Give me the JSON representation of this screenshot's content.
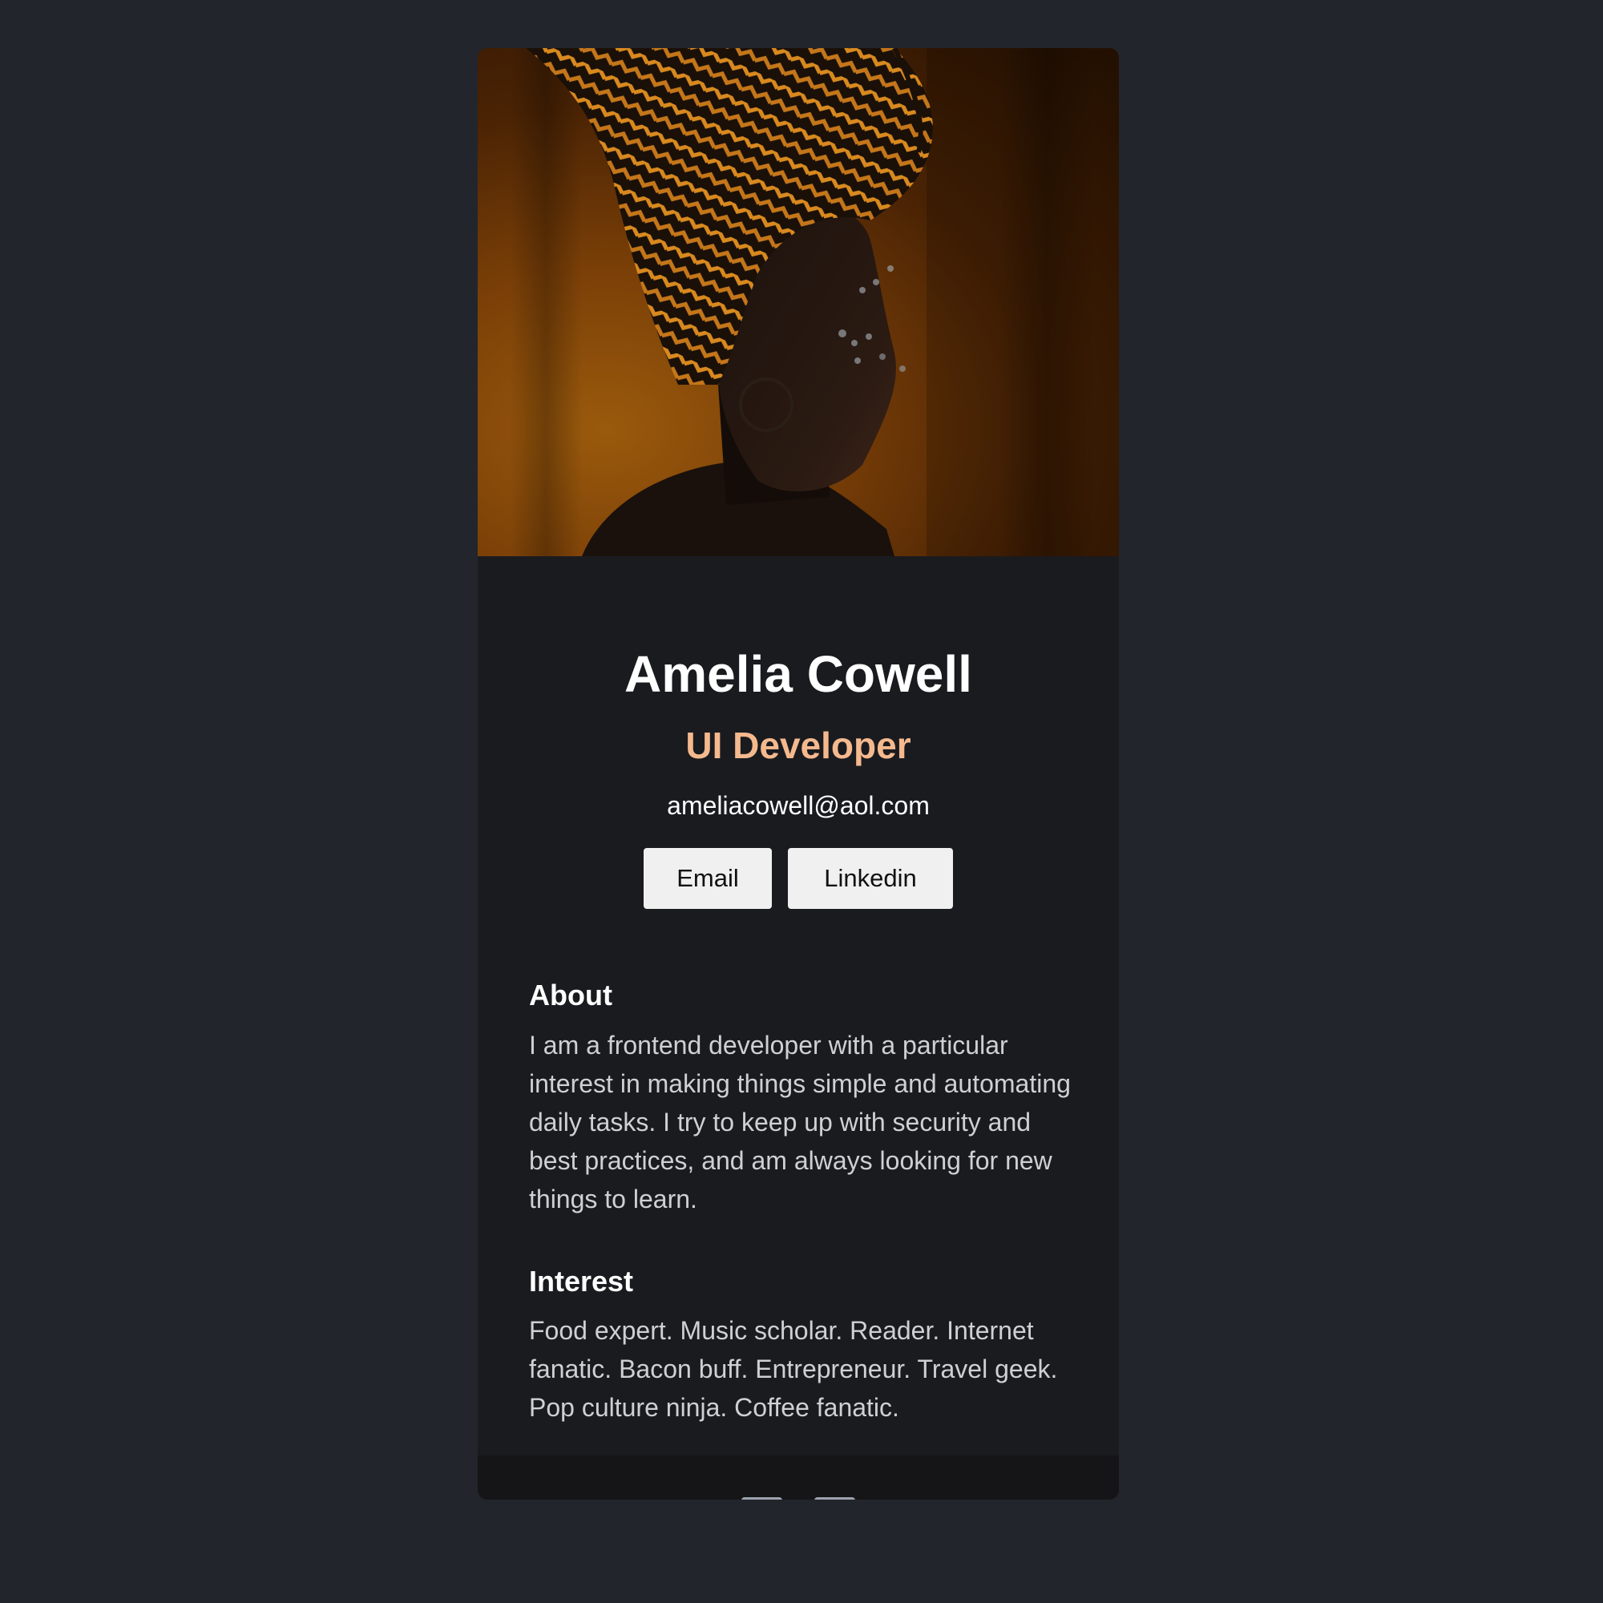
{
  "profile": {
    "name": "Amelia Cowell",
    "role": "UI Developer",
    "email": "ameliacowell@aol.com"
  },
  "buttons": {
    "email_label": "Email",
    "linkedin_label": "Linkedin"
  },
  "about": {
    "title": "About",
    "text": "I am a frontend developer with a particular interest in making things simple and automating daily tasks. I try to keep up with security and best practices, and am always looking for new things to learn."
  },
  "interest": {
    "title": "Interest",
    "text": "Food expert. Music scholar. Reader. Internet fanatic. Bacon buff. Entrepreneur. Travel geek. Pop culture ninja. Coffee fanatic."
  },
  "footer": {
    "icons": [
      "twitter-icon",
      "github-icon"
    ]
  },
  "colors": {
    "page_background": "#23252c",
    "card_background": "#1a1b1f",
    "footer_background": "#151517",
    "accent": "#f5b98e",
    "icon_gray": "#9ca3af"
  }
}
